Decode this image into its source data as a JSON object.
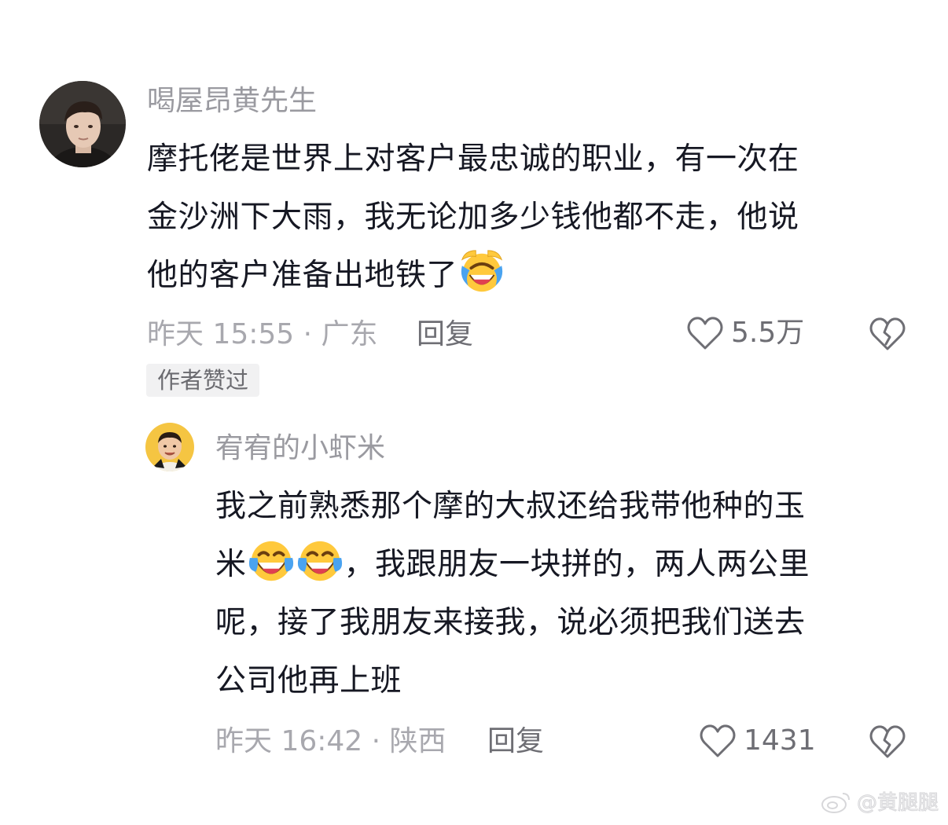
{
  "comments": [
    {
      "username": "喝屋昂黄先生",
      "avatar_icon": "avatar-man",
      "text_lines": [
        "摩托佬是世界上对客户最忠诚的职业，有一次在",
        "金沙洲下大雨，我无论加多少钱他都不走，他说",
        "他的客户准备出地铁了"
      ],
      "emoji_icon": "rofl-emoji",
      "meta": "昨天 15:55 · 广东",
      "reply_label": "回复",
      "like_count": "5.5万",
      "badge": "作者赞过"
    },
    {
      "username": "宥宥的小虾米",
      "avatar_icon": "avatar-child",
      "text_lines": [
        "我之前熟悉那个摩的大叔还给我带他种的玉",
        "米",
        "，我跟朋友一块拼的，两人两公里",
        "呢，接了我朋友来接我，说必须把我们送去",
        "公司他再上班"
      ],
      "emoji_icon": "tears-of-joy-emoji",
      "meta": "昨天 16:42 · 陕西",
      "reply_label": "回复",
      "like_count": "1431"
    }
  ],
  "watermark": {
    "icon": "weibo-icon",
    "text": "@黄腿腿"
  },
  "colors": {
    "username": "#9a9aa0",
    "body": "#161823",
    "meta": "#a8a8ae",
    "action": "#6e6e74",
    "badge_bg": "#f1f1f2",
    "emoji_yellow": "#ffc93c",
    "emoji_blue": "#4aa3f0"
  }
}
